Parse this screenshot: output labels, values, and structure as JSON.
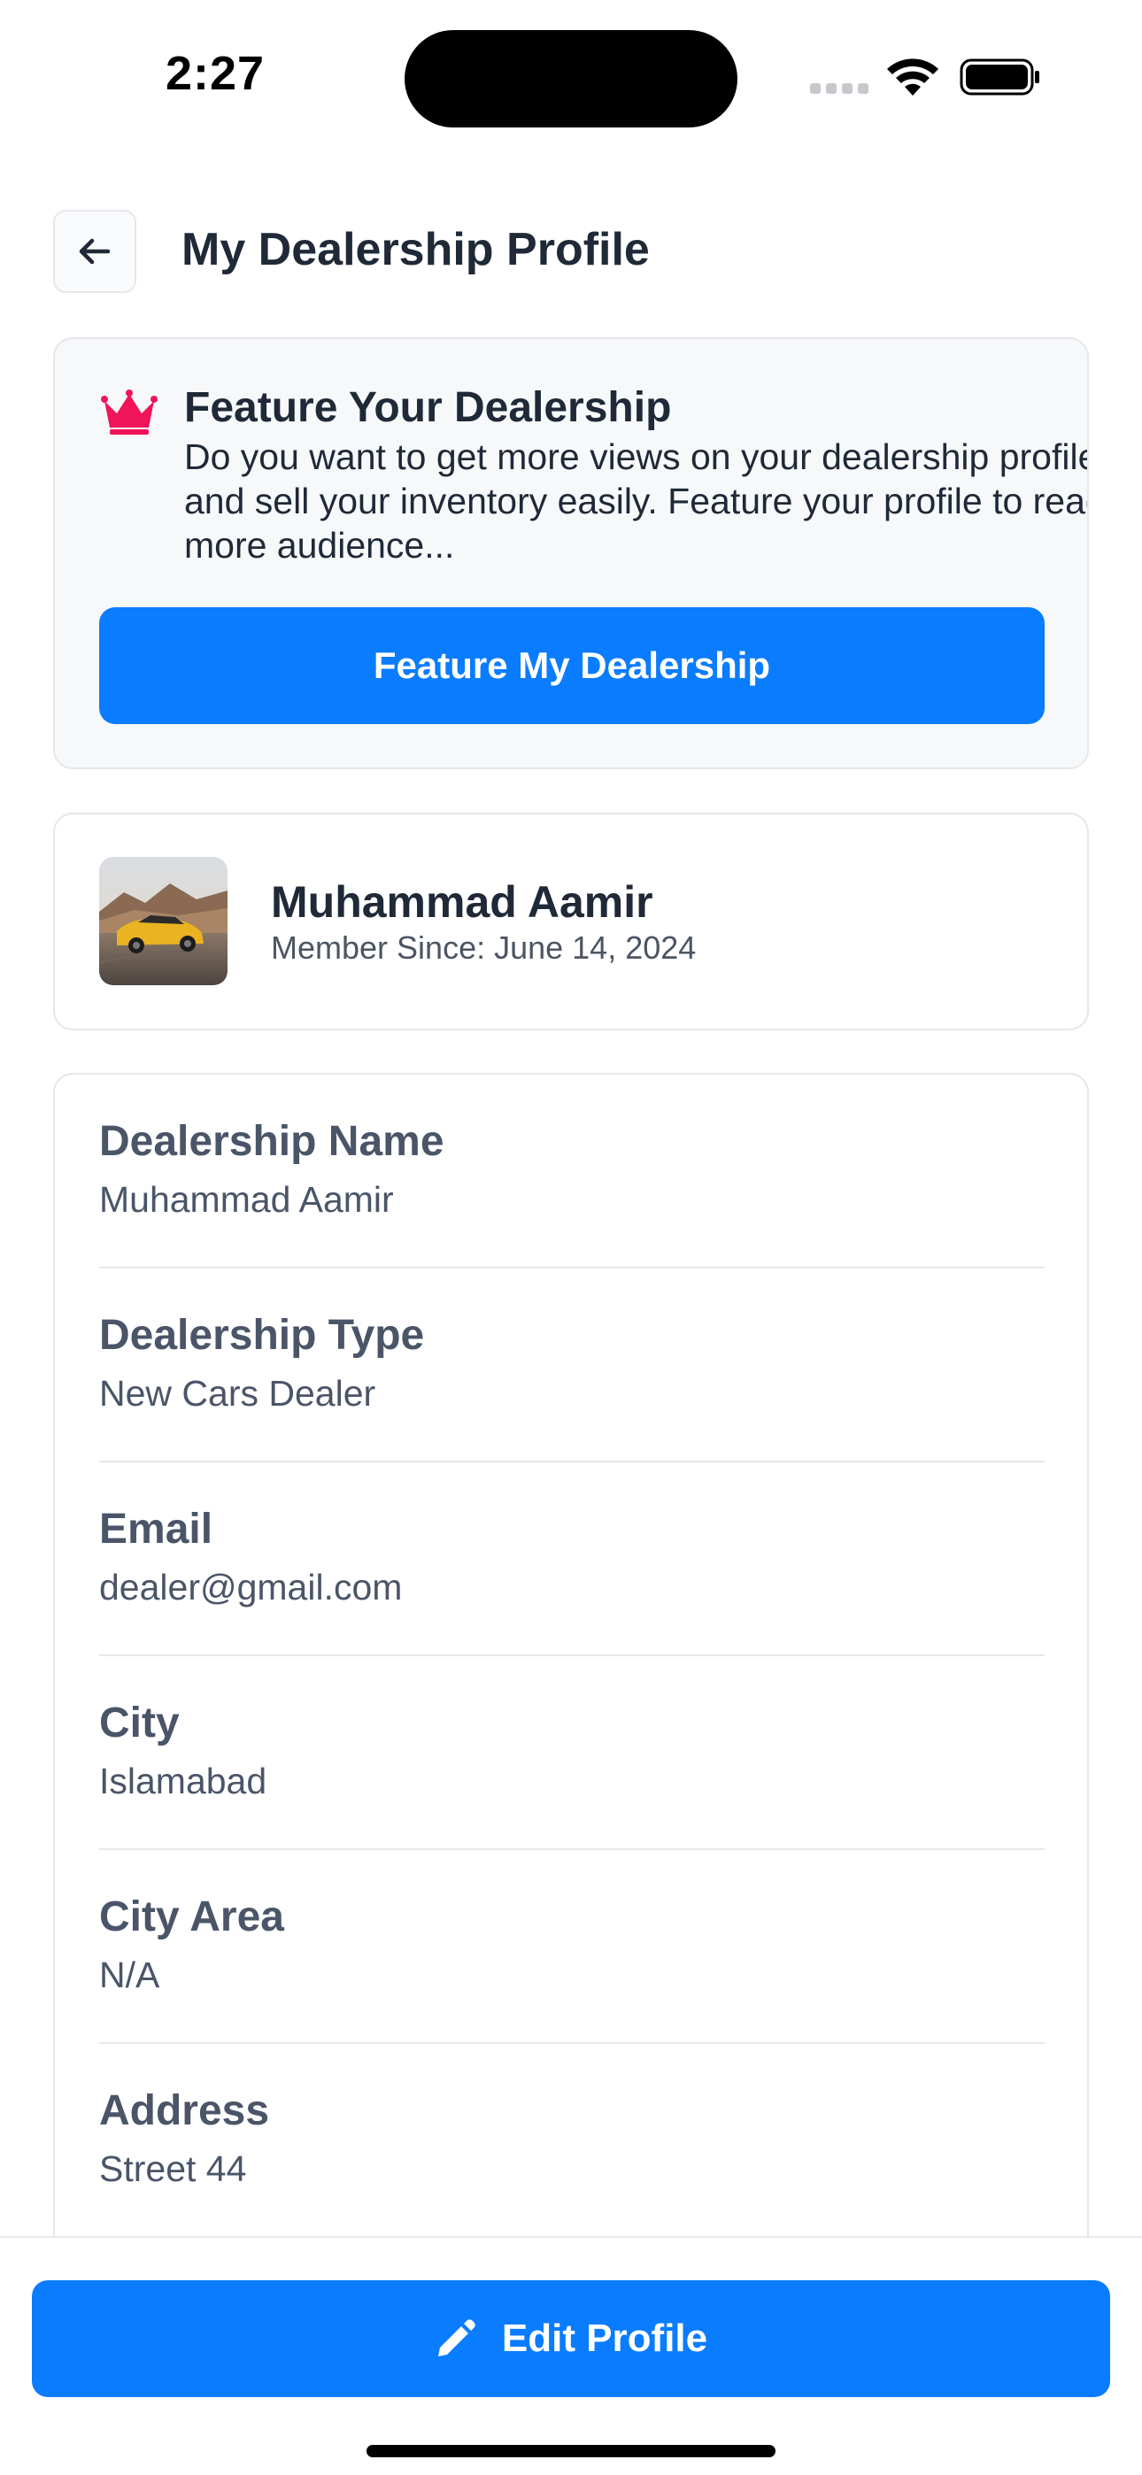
{
  "status_bar": {
    "time": "2:27"
  },
  "header": {
    "title": "My Dealership Profile",
    "back_icon": "arrow-left-icon"
  },
  "feature_card": {
    "icon": "crown-icon",
    "title": "Feature Your Dealership",
    "description": "Do you want to get more views on your dealership profile and sell your inventory easily. Feature your profile to read more audience...",
    "button_label": "Feature My Dealership"
  },
  "profile": {
    "name": "Muhammad Aamir",
    "member_since": "Member Since: June 14, 2024"
  },
  "details": [
    {
      "label": "Dealership Name",
      "value": "Muhammad Aamir"
    },
    {
      "label": "Dealership Type",
      "value": "New Cars Dealer"
    },
    {
      "label": "Email",
      "value": "dealer@gmail.com"
    },
    {
      "label": "City",
      "value": "Islamabad"
    },
    {
      "label": "City Area",
      "value": "N/A"
    },
    {
      "label": "Address",
      "value": "Street 44"
    }
  ],
  "footer": {
    "edit_button_label": "Edit Profile",
    "edit_icon": "pencil-icon"
  },
  "colors": {
    "primary": "#0a7cff",
    "crown": "#f0145a",
    "card_bg": "#f7f8fa",
    "border": "#e5e7eb"
  }
}
